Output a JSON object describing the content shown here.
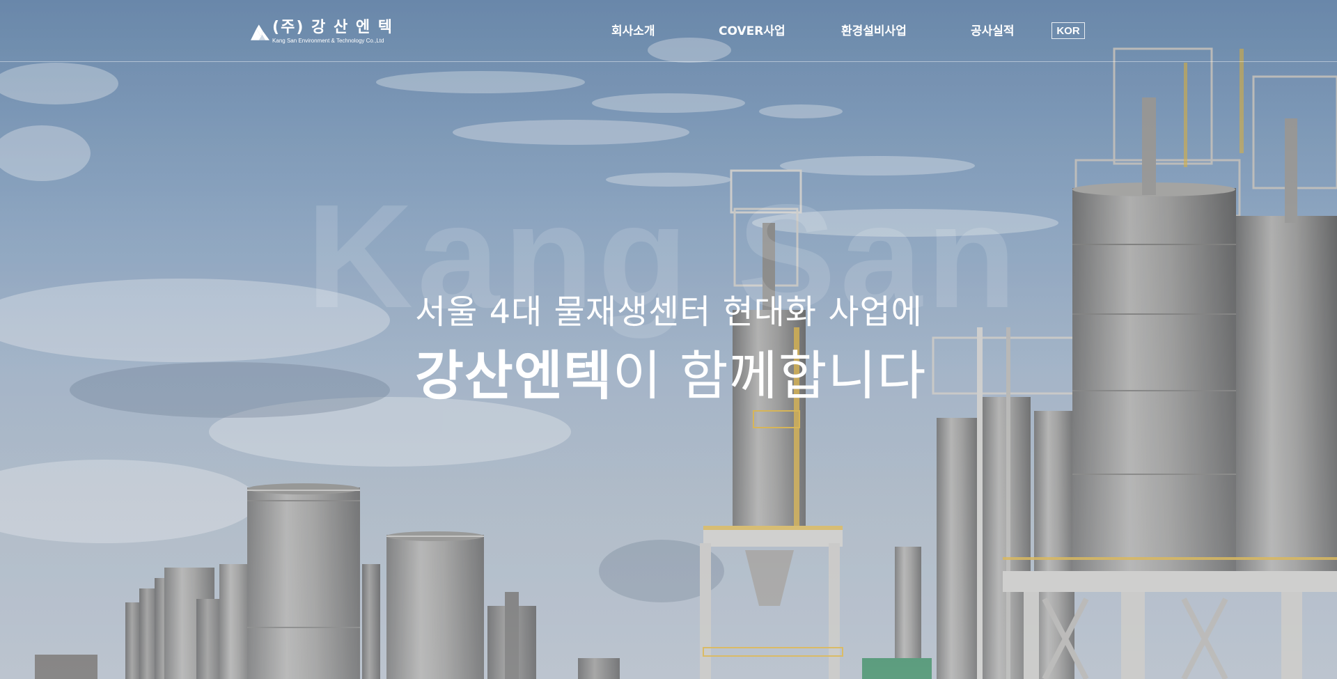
{
  "header": {
    "logo": {
      "korean": "(주) 강 산 엔 텍",
      "english": "Kang San Environment & Technology Co.,Ltd"
    },
    "nav": [
      {
        "label": "회사소개"
      },
      {
        "label": "COVER사업"
      },
      {
        "label": "환경설비사업"
      },
      {
        "label": "공사실적"
      }
    ],
    "language": "KOR"
  },
  "hero": {
    "watermark": "Kang San",
    "line1": "서울 4대 물재생센터 현대화 사업에",
    "line2_strong": "강산엔텍",
    "line2_rest": "이 함께합니다"
  },
  "colors": {
    "text": "#ffffff",
    "sky_top": "#6f8fb2",
    "sky_bottom": "#b7c2cf",
    "tank_steel": "#9a9a98",
    "safety_yellow": "#e3b53a"
  }
}
